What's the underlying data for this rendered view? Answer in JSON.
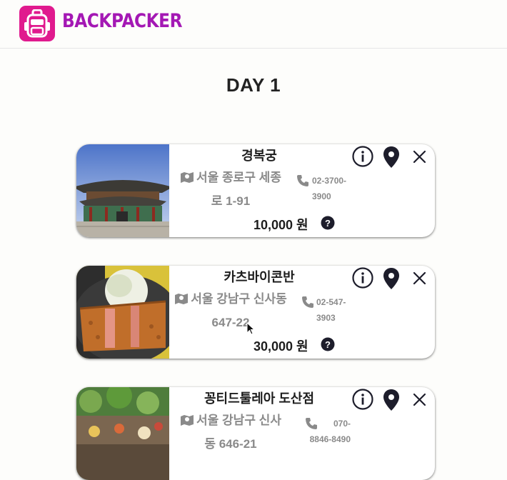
{
  "header": {
    "brand": "BACKPACKER",
    "logo_icon": "backpack-icon",
    "brand_color": "#a418b4",
    "logo_bg": "#e01a8e"
  },
  "day": {
    "title": "DAY 1"
  },
  "places": [
    {
      "name": "경복궁",
      "address_line1": "서울 종로구 세종",
      "address_line2": "로 1-91",
      "phone_line1": "02-3700-",
      "phone_line2": "3900",
      "price": "10,000 원",
      "photo": "palace-photo"
    },
    {
      "name": "카츠바이콘반",
      "address_line1": "서울 강남구 신사동",
      "address_line2": "647-22",
      "phone_line1": "02-547-",
      "phone_line2": "3903",
      "price": "30,000 원",
      "photo": "tonkatsu-photo"
    },
    {
      "name": "꽁티드툴레아 도산점",
      "address_line1": "서울 강남구 신사",
      "address_line2": "동 646-21",
      "phone_line1": "070-",
      "phone_line2": "8846-8490",
      "price": "",
      "photo": "restaurant-photo"
    }
  ]
}
